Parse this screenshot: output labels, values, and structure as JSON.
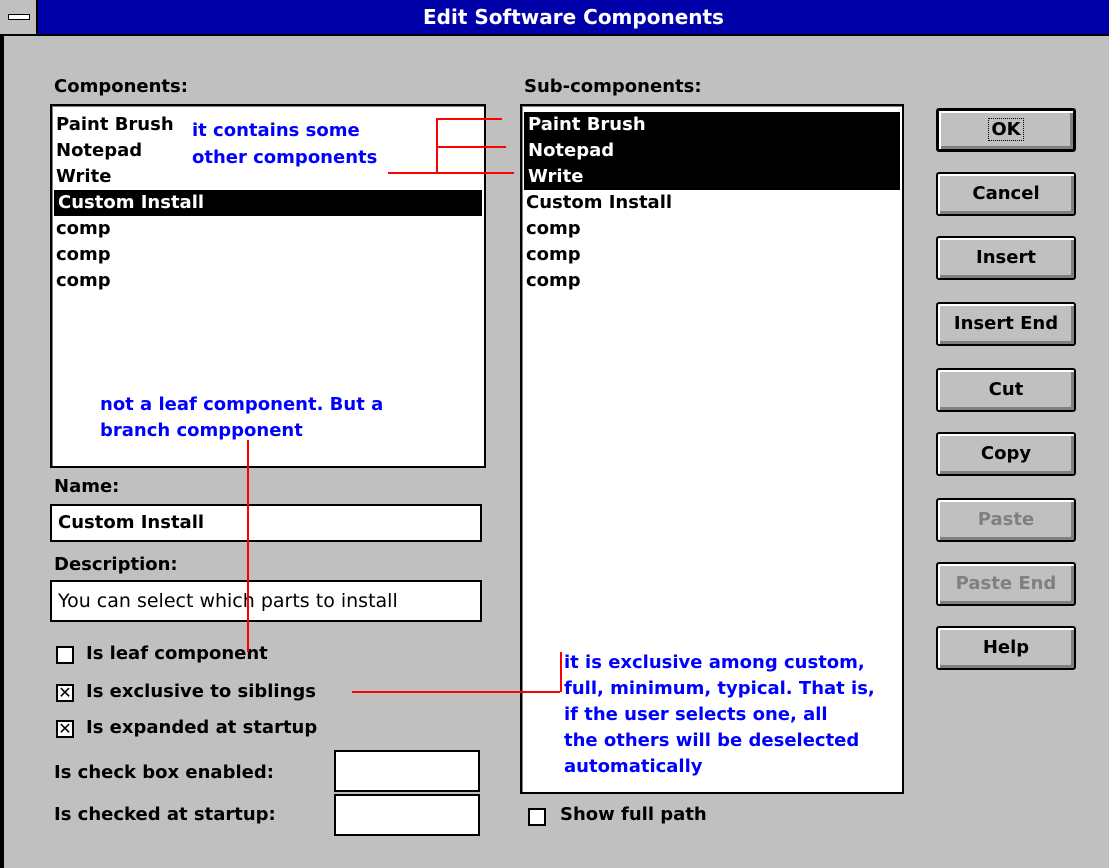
{
  "window": {
    "title": "Edit Software Components"
  },
  "components": {
    "label": "Components:",
    "items": [
      "Paint Brush",
      "Notepad",
      "Write",
      "Custom Install",
      "comp",
      "comp",
      "comp"
    ],
    "selected_index": 3
  },
  "subcomponents": {
    "label": "Sub-components:",
    "items": [
      "Paint Brush",
      "Notepad",
      "Write",
      "Custom Install",
      "comp",
      "comp",
      "comp"
    ],
    "selected_indices": [
      0,
      1,
      2
    ]
  },
  "name": {
    "label": "Name:",
    "value": "Custom Install"
  },
  "description": {
    "label": "Description:",
    "value": "You can select which parts to install"
  },
  "checkboxes": {
    "leaf": {
      "label": "Is leaf component",
      "checked": false
    },
    "exclusive": {
      "label": "Is exclusive to siblings",
      "checked": true
    },
    "expanded": {
      "label": "Is expanded at startup",
      "checked": true
    },
    "show_full_path": {
      "label": "Show full path",
      "checked": false
    }
  },
  "fields": {
    "checkbox_enabled": {
      "label": "Is check box enabled:",
      "value": ""
    },
    "checked_at_startup": {
      "label": "Is checked at startup:",
      "value": ""
    }
  },
  "buttons": {
    "ok": "OK",
    "cancel": "Cancel",
    "insert": "Insert",
    "insert_end": "Insert End",
    "cut": "Cut",
    "copy": "Copy",
    "paste": "Paste",
    "paste_end": "Paste End",
    "help": "Help"
  },
  "annotations": {
    "contains_1": "it contains some",
    "contains_2": "other components",
    "branch_1": "not a leaf component. But a",
    "branch_2": "branch compponent",
    "exclusive_1": "it is exclusive among custom,",
    "exclusive_2": "full, minimum, typical. That is,",
    "exclusive_3": "if the user selects one, all",
    "exclusive_4": "the others will be deselected",
    "exclusive_5": "automatically"
  },
  "colors": {
    "titlebar": "#0000a8",
    "annotation_text": "#0000ff",
    "annotation_line": "#ff0000",
    "face": "#c0c0c0"
  }
}
